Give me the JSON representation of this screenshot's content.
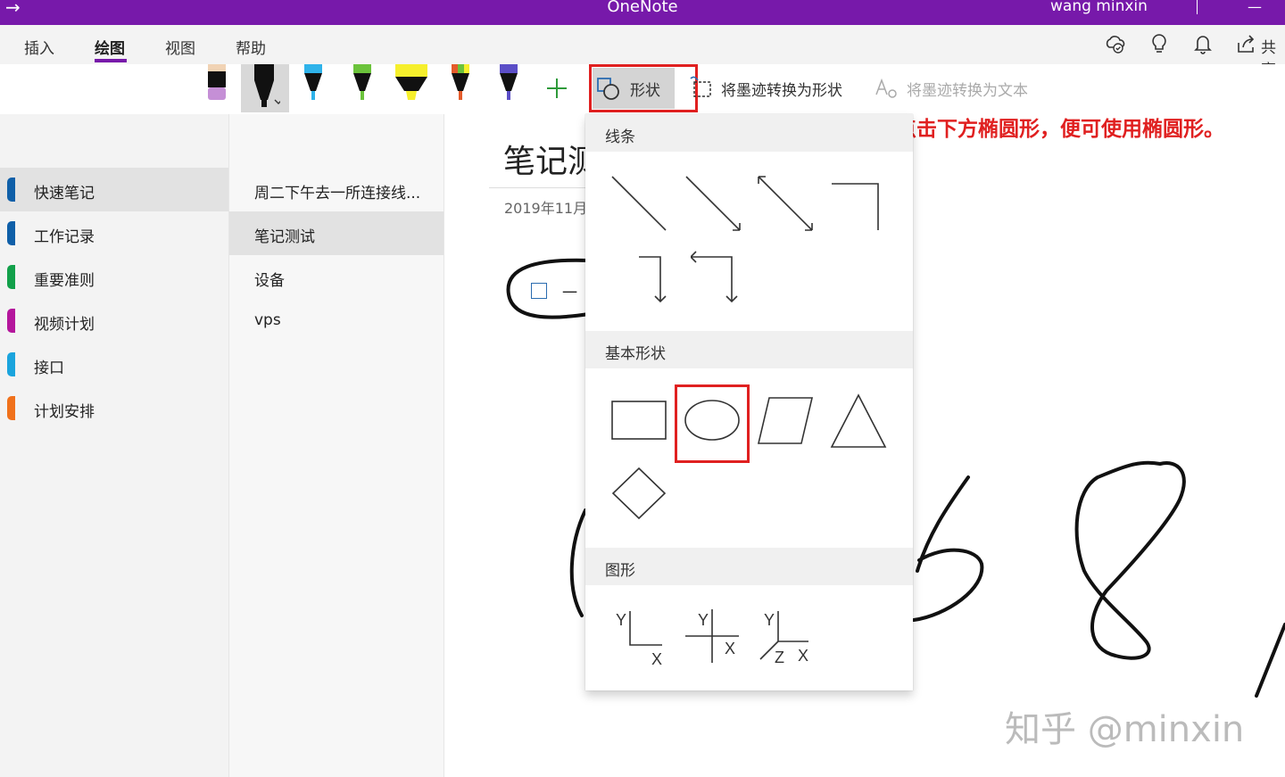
{
  "titlebar": {
    "title": "OneNote",
    "user": "wang minxin",
    "window_control": "—",
    "back_icon": "→"
  },
  "menu": {
    "tabs": [
      {
        "label": "插入"
      },
      {
        "label": "绘图"
      },
      {
        "label": "视图"
      },
      {
        "label": "帮助"
      }
    ],
    "active_tab": "绘图"
  },
  "top_right": {
    "share_label": "共享",
    "icons": [
      "sync-status-icon",
      "lightbulb-icon",
      "bell-icon",
      "share-icon"
    ]
  },
  "toolbar": {
    "pens": [
      {
        "name": "eraser",
        "color": "#c58fd6"
      },
      {
        "name": "black-pen",
        "color": "#111111",
        "selected": true
      },
      {
        "name": "blue-pen",
        "color": "#2fb3ea"
      },
      {
        "name": "green-pen",
        "color": "#6bc33b"
      },
      {
        "name": "yellow-highlighter",
        "color": "#f6ef2c"
      },
      {
        "name": "galaxy-pen",
        "color": "#e45b2a"
      },
      {
        "name": "rainbow-pen",
        "color": "#5b4ec7"
      }
    ],
    "add_pen": "+",
    "shapes_label": "形状",
    "convert_to_shapes": "将墨迹转换为形状",
    "convert_to_text": "将墨迹转换为文本"
  },
  "annotation": "点击形状按钮，然后点击下方椭圆形，便可使用椭圆形。",
  "sections": [
    {
      "label": "快速笔记",
      "color": "#0f5fa8",
      "selected": true
    },
    {
      "label": "工作记录",
      "color": "#0f5fa8"
    },
    {
      "label": "重要准则",
      "color": "#12a04a"
    },
    {
      "label": "视频计划",
      "color": "#b4169c"
    },
    {
      "label": "接口",
      "color": "#1aa4dd"
    },
    {
      "label": "计划安排",
      "color": "#f0711b"
    }
  ],
  "pages": [
    {
      "label": "周二下午去一所连接线..."
    },
    {
      "label": "笔记测试",
      "selected": true
    },
    {
      "label": "设备"
    },
    {
      "label": "vps"
    }
  ],
  "note": {
    "title": "笔记测",
    "date": "2019年11月",
    "todo_text": "一"
  },
  "dropdown": {
    "groups": [
      {
        "label": "线条",
        "items": [
          "line",
          "arrow",
          "double-arrow",
          "elbow-connector",
          "elbow-arrow",
          "elbow-double-arrow"
        ]
      },
      {
        "label": "基本形状",
        "items": [
          "rectangle",
          "ellipse",
          "parallelogram",
          "triangle",
          "diamond"
        ],
        "highlighted": "ellipse"
      },
      {
        "label": "图形",
        "items": [
          "xy-axis",
          "xy-cross-axis",
          "xyz-axis"
        ]
      }
    ],
    "axis_labels": {
      "x": "X",
      "y": "Y",
      "z": "Z"
    }
  },
  "watermark": "知乎 @minxin"
}
